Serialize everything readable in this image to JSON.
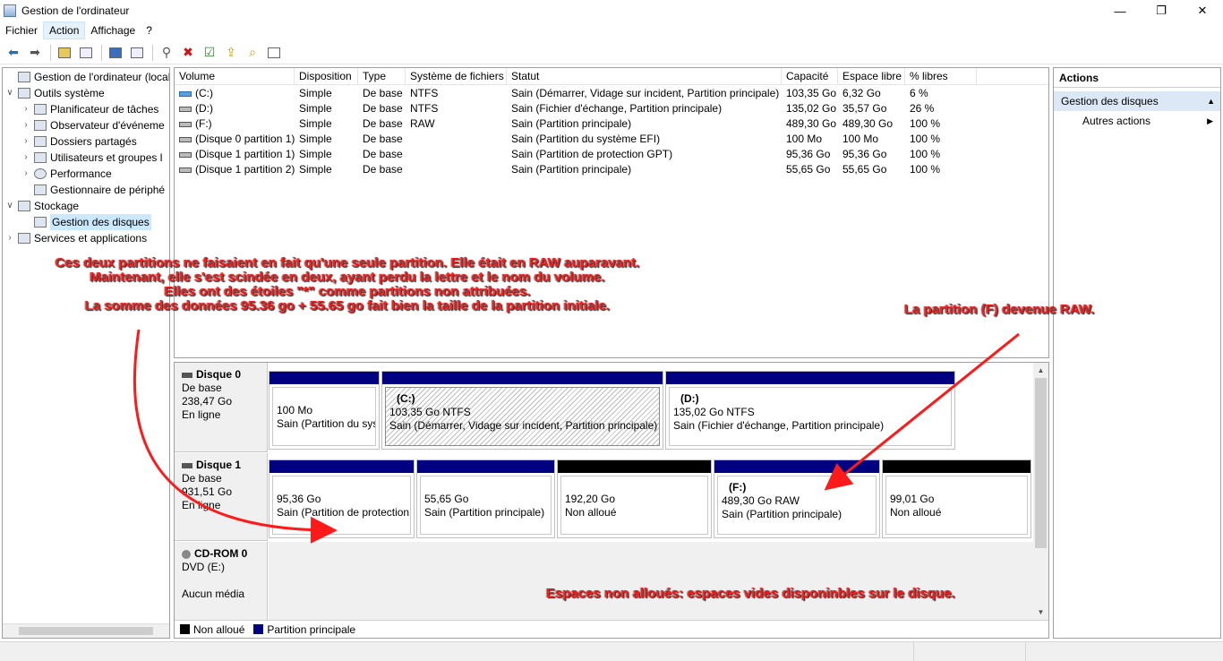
{
  "window": {
    "title": "Gestion de l'ordinateur",
    "minimize": "—",
    "maximize": "❐",
    "close": "✕"
  },
  "menu": {
    "items": [
      "Fichier",
      "Action",
      "Affichage",
      "?"
    ]
  },
  "tree": {
    "items": [
      {
        "label": "Gestion de l'ordinateur (local)",
        "expander": ""
      },
      {
        "label": "Outils système",
        "expander": "∨"
      },
      {
        "label": "Planificateur de tâches",
        "expander": "›"
      },
      {
        "label": "Observateur d'événeme",
        "expander": "›"
      },
      {
        "label": "Dossiers partagés",
        "expander": "›"
      },
      {
        "label": "Utilisateurs et groupes l",
        "expander": "›"
      },
      {
        "label": "Performance",
        "expander": "›"
      },
      {
        "label": "Gestionnaire de périphé",
        "expander": ""
      },
      {
        "label": "Stockage",
        "expander": "∨"
      },
      {
        "label": "Gestion des disques",
        "expander": ""
      },
      {
        "label": "Services et applications",
        "expander": "›"
      }
    ]
  },
  "volumes": {
    "headers": [
      "Volume",
      "Disposition",
      "Type",
      "Système de fichiers",
      "Statut",
      "Capacité",
      "Espace libre",
      "% libres"
    ],
    "rows": [
      [
        "(C:)",
        "Simple",
        "De base",
        "NTFS",
        "Sain (Démarrer, Vidage sur incident, Partition principale)",
        "103,35 Go",
        "6,32 Go",
        "6 %"
      ],
      [
        "(D:)",
        "Simple",
        "De base",
        "NTFS",
        "Sain (Fichier d'échange, Partition principale)",
        "135,02 Go",
        "35,57 Go",
        "26 %"
      ],
      [
        "(F:)",
        "Simple",
        "De base",
        "RAW",
        "Sain (Partition principale)",
        "489,30 Go",
        "489,30 Go",
        "100 %"
      ],
      [
        "(Disque 0 partition 1)",
        "Simple",
        "De base",
        "",
        "Sain (Partition du système EFI)",
        "100 Mo",
        "100 Mo",
        "100 %"
      ],
      [
        "(Disque 1 partition 1)",
        "Simple",
        "De base",
        "",
        "Sain (Partition de protection GPT)",
        "95,36 Go",
        "95,36 Go",
        "100 %"
      ],
      [
        "(Disque 1 partition 2)",
        "Simple",
        "De base",
        "",
        "Sain (Partition principale)",
        "55,65 Go",
        "55,65 Go",
        "100 %"
      ]
    ]
  },
  "disks": [
    {
      "name": "Disque 0",
      "type": "De base",
      "size": "238,47 Go",
      "state": "En ligne",
      "partitions": [
        {
          "title": "",
          "size": "100 Mo",
          "status": "Sain (Partition du sys"
        },
        {
          "title": "(C:)",
          "size": "103,35 Go NTFS",
          "status": "Sain (Démarrer, Vidage sur incident, Partition principale)"
        },
        {
          "title": "(D:)",
          "size": "135,02 Go NTFS",
          "status": "Sain (Fichier d'échange, Partition principale)"
        }
      ]
    },
    {
      "name": "Disque 1",
      "type": "De base",
      "size": "931,51 Go",
      "state": "En ligne",
      "partitions": [
        {
          "title": "",
          "size": "95,36 Go",
          "status": "Sain (Partition de protection"
        },
        {
          "title": "",
          "size": "55,65 Go",
          "status": "Sain (Partition principale)"
        },
        {
          "title": "",
          "size": "192,20 Go",
          "status": "Non alloué"
        },
        {
          "title": "(F:)",
          "size": "489,30 Go RAW",
          "status": "Sain (Partition principale)"
        },
        {
          "title": "",
          "size": "99,01 Go",
          "status": "Non alloué"
        }
      ]
    },
    {
      "name": "CD-ROM 0",
      "type": "DVD (E:)",
      "size": "",
      "state": "Aucun média",
      "partitions": []
    }
  ],
  "legend": {
    "unallocated": "Non alloué",
    "primary": "Partition principale",
    "unallocated_color": "#000000",
    "primary_color": "#000080"
  },
  "actions": {
    "header": "Actions",
    "section": "Gestion des disques",
    "item": "Autres actions"
  },
  "annotations": {
    "main": [
      "Ces deux partitions ne faisaient en fait qu'une seule partition. Elle était en RAW auparavant.",
      "Maintenant, elle s'est scindée en deux, ayant perdu la lettre et le nom du volume.",
      "Elles ont des étoiles \"*\" comme partitions non attribuées.",
      "La somme des données 95.36 go + 55.65 go fait bien la taille de la partition initiale."
    ],
    "raw": "La partition (F) devenue RAW.",
    "unallocated": "Espaces non alloués: espaces vides disponinbles sur le disque.",
    "color": "#ff1a1a"
  }
}
